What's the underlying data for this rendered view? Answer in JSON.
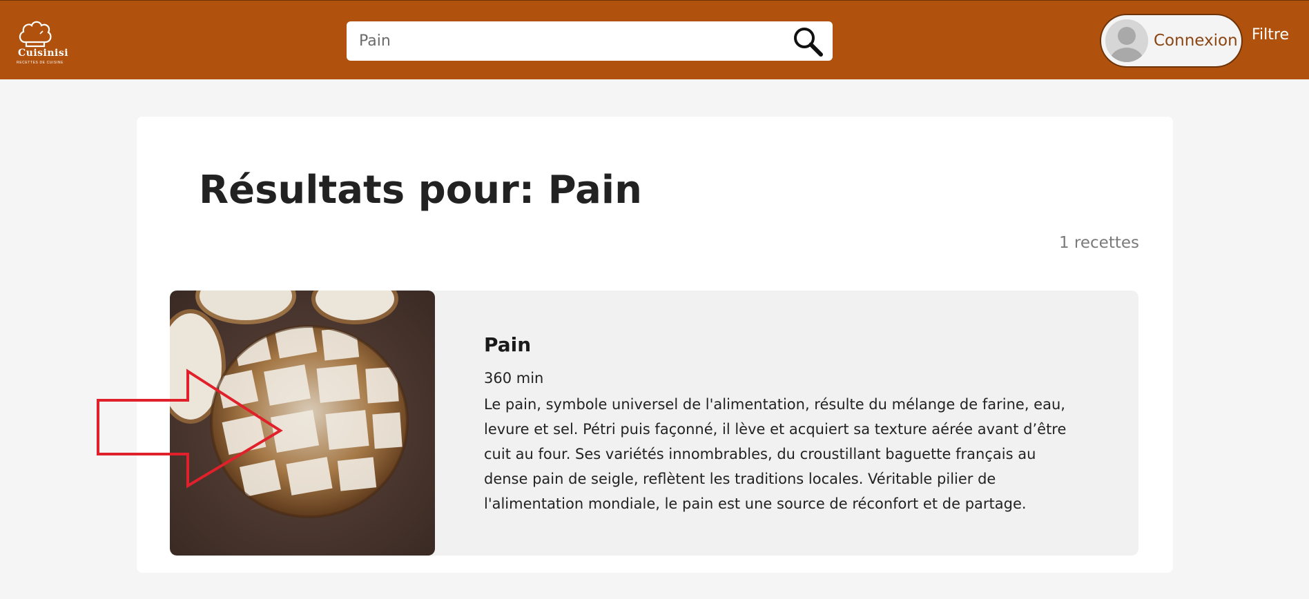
{
  "header": {
    "logo": {
      "name": "Cuisinisi",
      "tagline": "RECETTES DE CUISINE"
    },
    "search": {
      "value": "Pain",
      "placeholder": "Pain",
      "icon": "search-icon"
    },
    "login": {
      "label": "Connexion",
      "avatar_icon": "user-avatar-icon"
    },
    "filter": {
      "label": "Filtre"
    }
  },
  "colors": {
    "header_bg": "#b0520d",
    "page_bg": "#f5f5f5",
    "card_bg": "#ffffff",
    "recipe_bg": "#f1f1f1",
    "annotation": "#e0202a"
  },
  "main": {
    "title": "Résultats pour: Pain",
    "count": "1 recettes",
    "results": [
      {
        "title": "Pain",
        "duration": "360 min",
        "description": "Le pain, symbole universel de l'alimentation, résulte du mélange de farine, eau, levure et sel. Pétri puis façonné, il lève et acquiert sa texture aérée avant d’être cuit au four. Ses variétés innombrables, du croustillant baguette français au dense pain de seigle, reflètent les traditions locales. Véritable pilier de l'alimentation mondiale, le pain est une source de réconfort et de partage.",
        "image": "bread-loaf-photo"
      }
    ]
  }
}
